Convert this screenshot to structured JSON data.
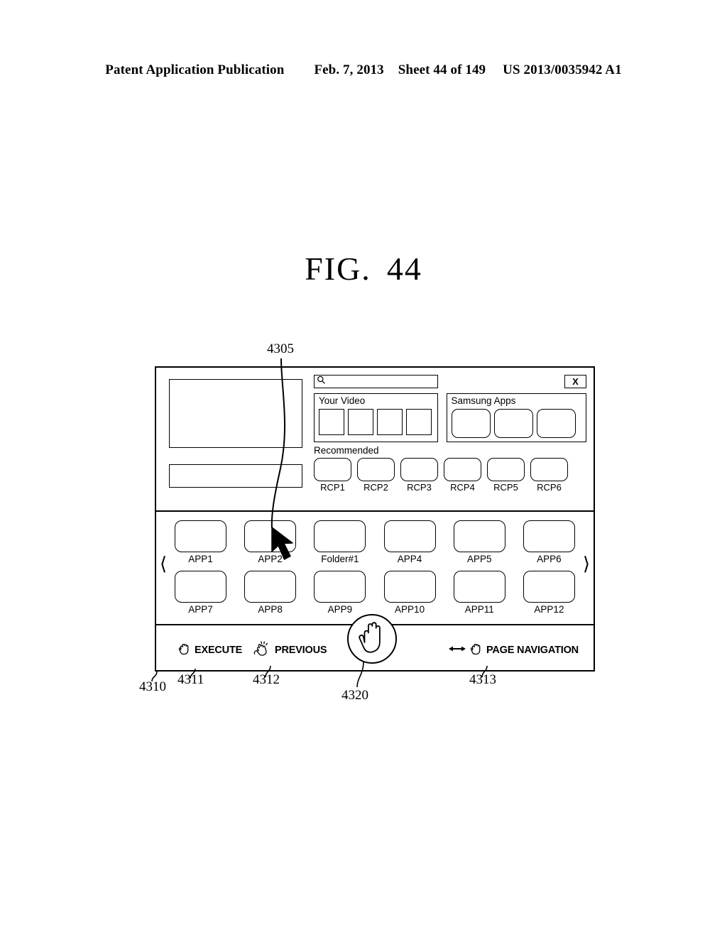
{
  "header": {
    "publication": "Patent Application Publication",
    "date": "Feb. 7, 2013",
    "sheet": "Sheet 44 of 149",
    "patent_number": "US 2013/0035942 A1"
  },
  "figure": {
    "label": "FIG.",
    "number": "44"
  },
  "screen": {
    "search": {
      "value": "",
      "placeholder": "",
      "icon": "search-icon"
    },
    "close_button": {
      "label": "X",
      "icon": "close-icon"
    },
    "panels": [
      {
        "title": "Your Video",
        "tile_count": 4,
        "tile_shape": "square"
      },
      {
        "title": "Samsung Apps",
        "tile_count": 3,
        "tile_shape": "rounded"
      }
    ],
    "recommended": {
      "title": "Recommended",
      "items": [
        "RCP1",
        "RCP2",
        "RCP3",
        "RCP4",
        "RCP5",
        "RCP6"
      ]
    },
    "app_grid": {
      "prev_page_icon": "chevron-left-icon",
      "next_page_icon": "chevron-right-icon",
      "row1": [
        "APP1",
        "APP2",
        "Folder#1",
        "APP4",
        "APP5",
        "APP6"
      ],
      "row2": [
        "APP7",
        "APP8",
        "APP9",
        "APP10",
        "APP11",
        "APP12"
      ]
    },
    "gesture_bar": [
      {
        "icon": "grab-hand-icon",
        "label": "EXECUTE"
      },
      {
        "icon": "wave-hand-icon",
        "label": "PREVIOUS"
      },
      {
        "icon": "double-arrow-hand-icon",
        "label": "PAGE NAVIGATION"
      }
    ],
    "hand_cursor_icon": "open-palm-hand-icon",
    "pointer_cursor_icon": "arrow-pointer-icon"
  },
  "reference_numerals": {
    "pointer": "4305",
    "frame": "4310",
    "execute": "4311",
    "previous": "4312",
    "hand_cursor": "4320",
    "page_navigation": "4313"
  }
}
